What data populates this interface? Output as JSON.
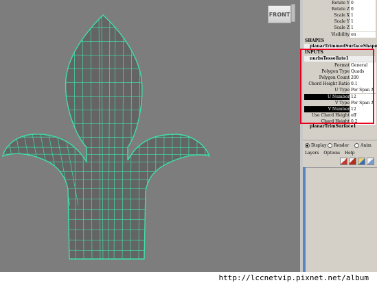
{
  "viewport": {
    "view_cube_label": "FRONT",
    "background": "#7d7d7d",
    "shape_fill": "#646464",
    "wire_color": "#3fe0a8"
  },
  "channel_box": {
    "top_attrs": [
      {
        "label": "Rotate Y",
        "value": "0"
      },
      {
        "label": "Rotate Z",
        "value": "0"
      },
      {
        "label": "Scale X",
        "value": "1"
      },
      {
        "label": "Scale Y",
        "value": "1"
      },
      {
        "label": "Scale Z",
        "value": "1"
      },
      {
        "label": "Visibility",
        "value": "on"
      }
    ],
    "shapes_header": "SHAPES",
    "shape_node": "planarTrimmedSurfaceShape1",
    "inputs_header": "INPUTS",
    "input_node": "nurbsTessellate1",
    "input_attrs": [
      {
        "label": "Format",
        "value": "General",
        "dark": false
      },
      {
        "label": "Polygon Type",
        "value": "Quads",
        "dark": false
      },
      {
        "label": "Polygon Count",
        "value": "200",
        "dark": false
      },
      {
        "label": "Chord Height Ratio",
        "value": "0.1",
        "dark": false
      },
      {
        "label": "U Type",
        "value": "Per Span # of",
        "dark": false
      },
      {
        "label": "U Number",
        "value": "12",
        "dark": true
      },
      {
        "label": "V Type",
        "value": "Per Span # of",
        "dark": false
      },
      {
        "label": "V Number",
        "value": "12",
        "dark": true
      },
      {
        "label": "Use Chord Height",
        "value": "off",
        "dark": false
      },
      {
        "label": "Chord Height",
        "value": "0.2",
        "dark": false
      }
    ],
    "next_node": "planarTrimSurface1",
    "highlight_color": "#e8001c"
  },
  "layer_editor": {
    "modes": [
      {
        "label": "Display",
        "selected": true
      },
      {
        "label": "Render",
        "selected": false
      },
      {
        "label": "Anim",
        "selected": false
      }
    ],
    "menus": [
      "Layers",
      "Options",
      "Help"
    ],
    "tool_icons": [
      "new-layer-icon",
      "new-layer-selected-icon",
      "delete-layer-icon",
      "layer-edit-icon"
    ]
  },
  "watermark": "http://lccnetvip.pixnet.net/album"
}
